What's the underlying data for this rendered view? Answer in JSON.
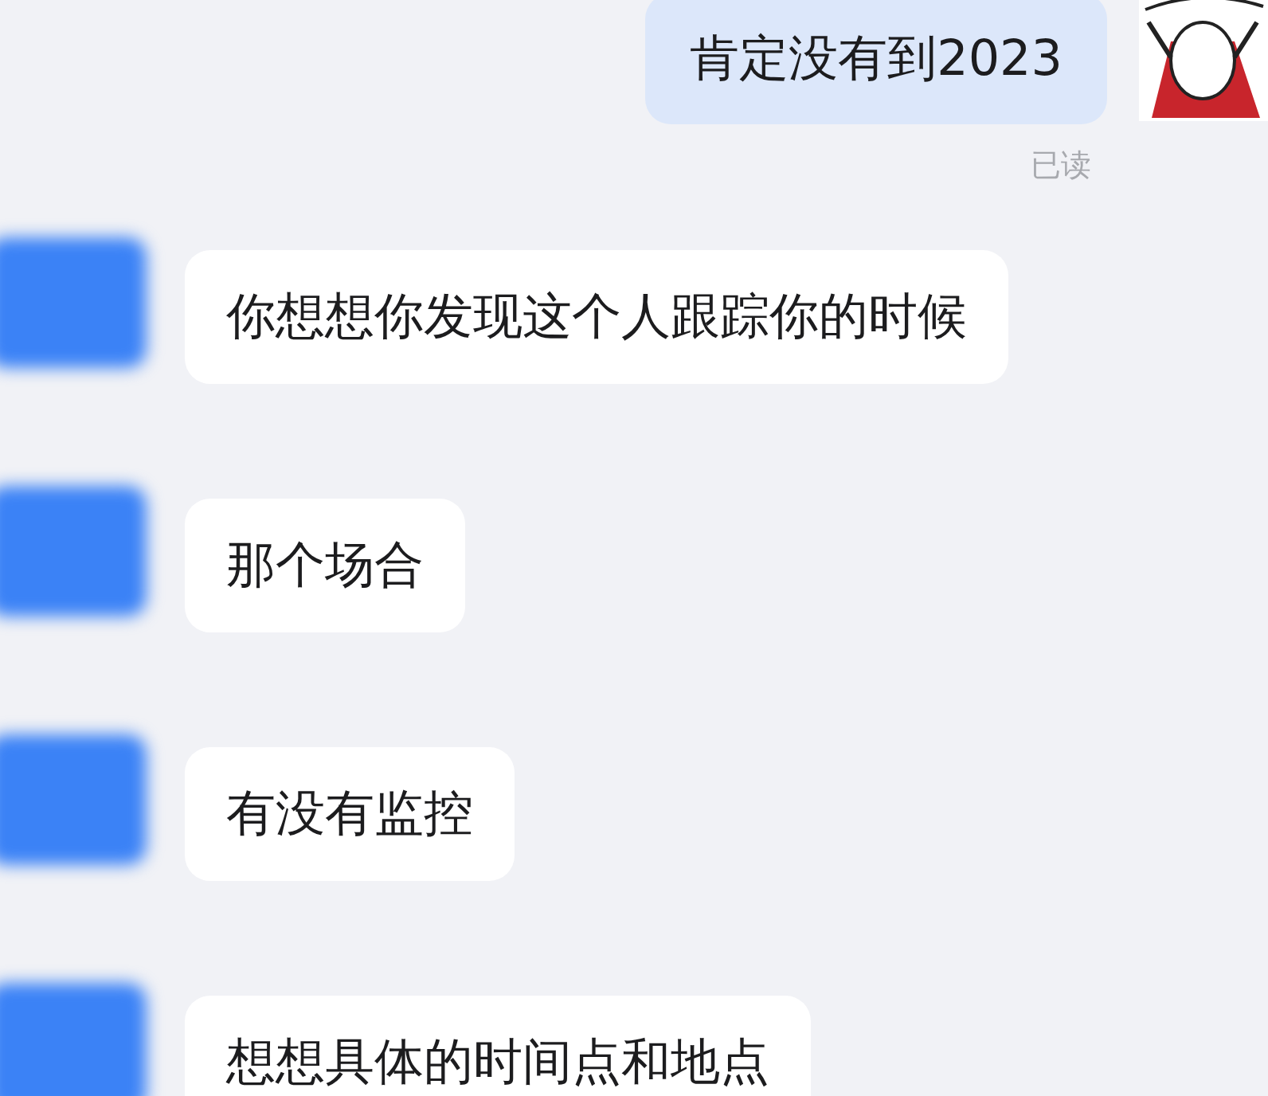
{
  "messages": [
    {
      "kind": "sent",
      "text": "肯定没有到2023",
      "status": "已读"
    },
    {
      "kind": "received",
      "text": "你想想你发现这个人跟踪你的时候"
    },
    {
      "kind": "received",
      "text": "那个场合"
    },
    {
      "kind": "received",
      "text": "有没有监控"
    },
    {
      "kind": "received",
      "text": "想想具体的时间点和地点"
    }
  ]
}
